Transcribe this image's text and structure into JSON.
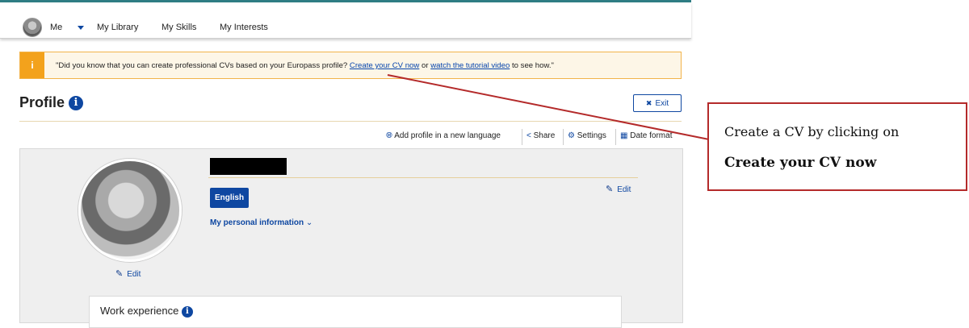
{
  "nav": {
    "me_label": "Me",
    "library_label": "My Library",
    "skills_label": "My Skills",
    "interests_label": "My Interests"
  },
  "alert": {
    "icon_label": "i",
    "text_before": "\"Did you know that you can create professional CVs based on your Europass profile?",
    "create_cv_link": "Create your CV now",
    "text_or": "or",
    "tutorial_link": "watch the tutorial video",
    "text_after": "to see how.\""
  },
  "profile": {
    "title": "Profile",
    "info_icon": "i",
    "exit_label": "Exit",
    "exit_icon": "✖"
  },
  "actions": {
    "add_language": "Add profile in a new language",
    "share": "Share",
    "settings": "Settings",
    "date_format": "Date format"
  },
  "card": {
    "photo_edit_label": "Edit",
    "edit_label": "Edit",
    "language_button": "English",
    "personal_info": "My personal information",
    "work_experience": "Work experience"
  },
  "callout": {
    "line1": "Create a CV by clicking on",
    "line2": "Create your CV now"
  },
  "colors": {
    "primary": "#0e47a1",
    "alert_accent": "#f3a21c",
    "callout_border": "#b42a2a"
  }
}
